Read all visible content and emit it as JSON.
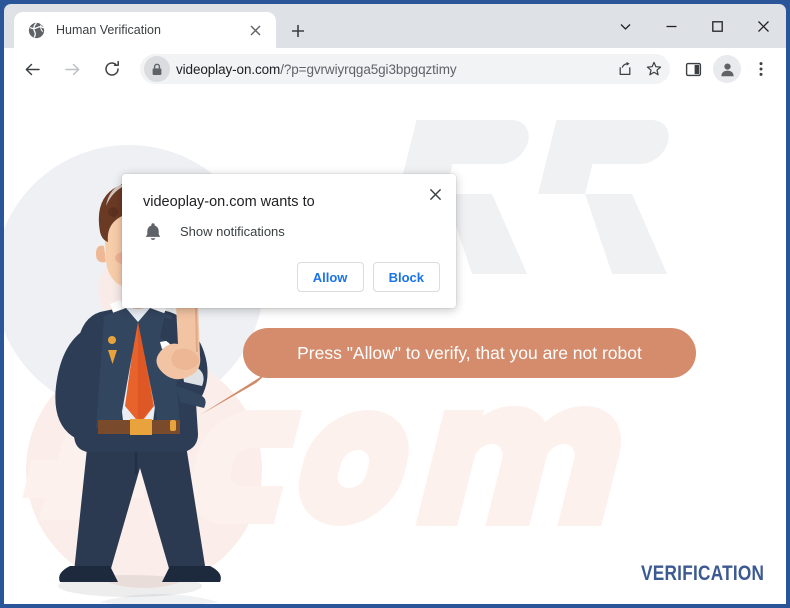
{
  "browser": {
    "tab": {
      "title": "Human Verification",
      "favicon_icon": "globe-icon",
      "close_icon": "close-icon"
    },
    "new_tab_label": "+",
    "window_controls": {
      "tab_search_icon": "chevron-down-icon",
      "minimize_icon": "minimize-icon",
      "maximize_icon": "maximize-icon",
      "close_icon": "close-icon"
    },
    "toolbar": {
      "back_icon": "back-arrow-icon",
      "forward_icon": "forward-arrow-icon",
      "reload_icon": "reload-icon",
      "lock_icon": "lock-icon",
      "url_host": "videoplay-on.com",
      "url_path": "/?p=gvrwiyrqga5gi3bpgqztimy",
      "url_full": "videoplay-on.com/?p=gvrwiyrqga5gi3bpgqztimy",
      "share_icon": "share-icon",
      "bookmark_icon": "star-icon",
      "side_panel_icon": "side-panel-icon",
      "profile_icon": "profile-avatar-icon",
      "menu_icon": "three-dot-menu-icon"
    }
  },
  "permission_dialog": {
    "title": "videoplay-on.com wants to",
    "item_label": "Show notifications",
    "item_icon": "bell-icon",
    "close_icon": "close-icon",
    "allow_label": "Allow",
    "block_label": "Block",
    "button_color": "#1a73e8"
  },
  "page": {
    "bubble_text": "Press \"Allow\" to verify, that you are not robot",
    "bubble_color": "#d48c6c",
    "verification_label": "VERIFICATION",
    "verification_color": "#3c5a92",
    "character_alt": "cartoon-businessman-pointing-up"
  }
}
